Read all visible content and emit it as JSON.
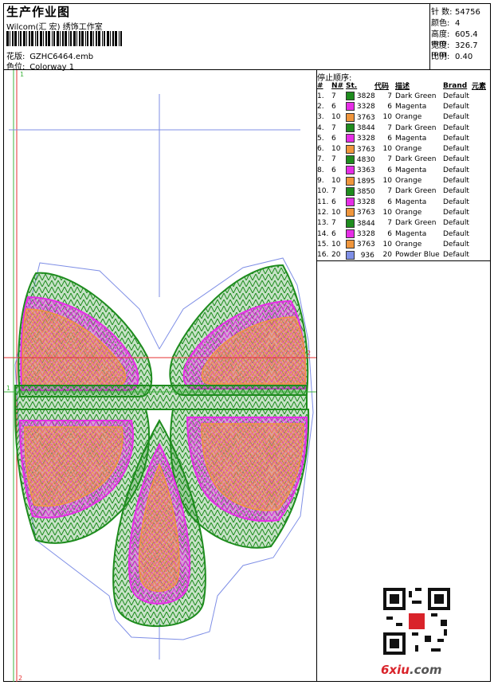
{
  "header": {
    "title": "生产作业图",
    "company": "Wilcom(汇 宏) 绣饰工作室",
    "design_label": "花版:",
    "design_value": "GZHC6464.emb",
    "colorway_label": "色位:",
    "colorway_value": "Colorway 1"
  },
  "stats": [
    {
      "label": "针 数:",
      "value": "54756"
    },
    {
      "label": "颜色:",
      "value": "4"
    },
    {
      "label": "高度:",
      "value": "605.4 mm"
    },
    {
      "label": "宽度:",
      "value": "326.7 mm"
    },
    {
      "label": "比例:",
      "value": "0.40"
    }
  ],
  "stop_sequence": {
    "title": "停止顺序:",
    "headers": [
      "#",
      "N#",
      "St.",
      "代码",
      "描述",
      "Brand",
      "元素"
    ],
    "rows": [
      {
        "no": "1.",
        "n": "7",
        "color": "#1e8c1e",
        "st": "3828",
        "code": "7",
        "desc": "Dark Green",
        "brand": "Default"
      },
      {
        "no": "2.",
        "n": "6",
        "color": "#e62de6",
        "st": "3328",
        "code": "6",
        "desc": "Magenta",
        "brand": "Default"
      },
      {
        "no": "3.",
        "n": "10",
        "color": "#f0963c",
        "st": "3763",
        "code": "10",
        "desc": "Orange",
        "brand": "Default"
      },
      {
        "no": "4.",
        "n": "7",
        "color": "#1e8c1e",
        "st": "3844",
        "code": "7",
        "desc": "Dark Green",
        "brand": "Default"
      },
      {
        "no": "5.",
        "n": "6",
        "color": "#e62de6",
        "st": "3328",
        "code": "6",
        "desc": "Magenta",
        "brand": "Default"
      },
      {
        "no": "6.",
        "n": "10",
        "color": "#f0963c",
        "st": "3763",
        "code": "10",
        "desc": "Orange",
        "brand": "Default"
      },
      {
        "no": "7.",
        "n": "7",
        "color": "#1e8c1e",
        "st": "4830",
        "code": "7",
        "desc": "Dark Green",
        "brand": "Default"
      },
      {
        "no": "8.",
        "n": "6",
        "color": "#e62de6",
        "st": "3363",
        "code": "6",
        "desc": "Magenta",
        "brand": "Default"
      },
      {
        "no": "9.",
        "n": "10",
        "color": "#f0963c",
        "st": "1895",
        "code": "10",
        "desc": "Orange",
        "brand": "Default"
      },
      {
        "no": "10.",
        "n": "7",
        "color": "#1e8c1e",
        "st": "3850",
        "code": "7",
        "desc": "Dark Green",
        "brand": "Default"
      },
      {
        "no": "11.",
        "n": "6",
        "color": "#e62de6",
        "st": "3328",
        "code": "6",
        "desc": "Magenta",
        "brand": "Default"
      },
      {
        "no": "12.",
        "n": "10",
        "color": "#f0963c",
        "st": "3763",
        "code": "10",
        "desc": "Orange",
        "brand": "Default"
      },
      {
        "no": "13.",
        "n": "7",
        "color": "#1e8c1e",
        "st": "3844",
        "code": "7",
        "desc": "Dark Green",
        "brand": "Default"
      },
      {
        "no": "14.",
        "n": "6",
        "color": "#e62de6",
        "st": "3328",
        "code": "6",
        "desc": "Magenta",
        "brand": "Default"
      },
      {
        "no": "15.",
        "n": "10",
        "color": "#f0963c",
        "st": "3763",
        "code": "10",
        "desc": "Orange",
        "brand": "Default"
      },
      {
        "no": "16.",
        "n": "20",
        "color": "#7f8fe6",
        "st": "936",
        "code": "20",
        "desc": "Powder Blue",
        "brand": "Default"
      }
    ]
  },
  "canvas_markers": {
    "left_top": "1",
    "left_bottom": "2",
    "right_mid": "2",
    "left_mid": "1"
  },
  "watermark": {
    "main": "6xiu",
    "suffix": ".com"
  },
  "icons": {
    "qr": "qr-code-icon",
    "barcode": "barcode-icon"
  }
}
